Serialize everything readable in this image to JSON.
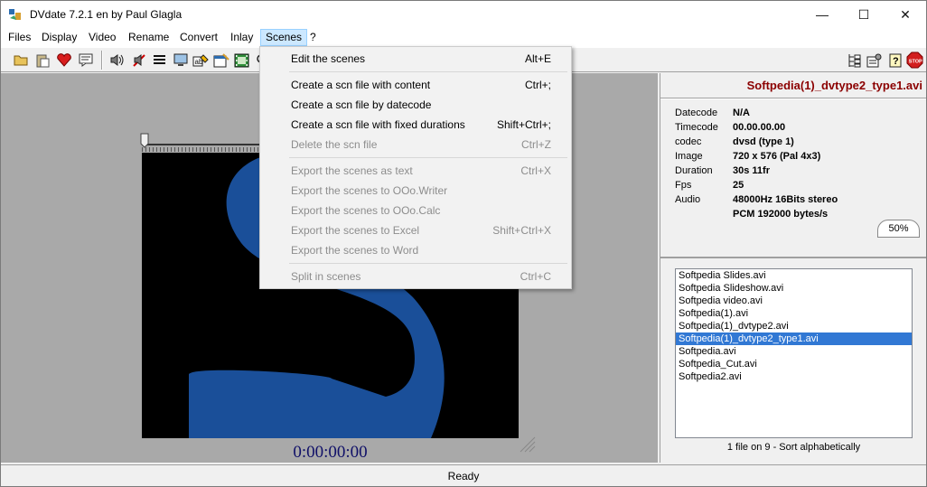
{
  "window": {
    "title": "DVdate 7.2.1 en by Paul Glagla",
    "min_glyph": "—",
    "max_glyph": "☐",
    "close_glyph": "✕"
  },
  "menubar": {
    "items": [
      {
        "label": "Files"
      },
      {
        "label": "Display"
      },
      {
        "label": "Video"
      },
      {
        "label": "Rename"
      },
      {
        "label": "Convert"
      },
      {
        "label": "Inlay"
      },
      {
        "label": "Scenes"
      },
      {
        "label": "?"
      }
    ],
    "active": "Scenes"
  },
  "toolbar": {
    "icons": [
      "open-folder-icon",
      "paste-icon",
      "favorite-heart-icon",
      "comment-icon",
      "speaker-icon",
      "mute-icon",
      "list-icon",
      "monitor-icon",
      "rename-icon",
      "calendar-icon",
      "film-icon",
      "search-icon",
      "tree-view-icon",
      "settings-icon",
      "help-icon",
      "stop-icon"
    ]
  },
  "scenes_menu": {
    "items": [
      {
        "label": "Edit the scenes",
        "shortcut": "Alt+E",
        "enabled": true
      },
      {
        "label": "Create a scn file with content",
        "shortcut": "Ctrl+;",
        "enabled": true
      },
      {
        "label": "Create a scn file by datecode",
        "shortcut": "",
        "enabled": true
      },
      {
        "label": "Create a scn file with fixed durations",
        "shortcut": "Shift+Ctrl+;",
        "enabled": true
      },
      {
        "label": "Delete the scn file",
        "shortcut": "Ctrl+Z",
        "enabled": false
      },
      {
        "label": "Export the scenes as text",
        "shortcut": "Ctrl+X",
        "enabled": false
      },
      {
        "label": "Export the scenes to OOo.Writer",
        "shortcut": "",
        "enabled": false
      },
      {
        "label": "Export the scenes to OOo.Calc",
        "shortcut": "",
        "enabled": false
      },
      {
        "label": "Export the scenes to Excel",
        "shortcut": "Shift+Ctrl+X",
        "enabled": false
      },
      {
        "label": "Export the scenes to Word",
        "shortcut": "",
        "enabled": false
      },
      {
        "label": "Split in scenes",
        "shortcut": "Ctrl+C",
        "enabled": false
      }
    ]
  },
  "player": {
    "timecode": "0:00:00:00"
  },
  "info": {
    "file_title": "Softpedia(1)_dvtype2_type1.avi",
    "fields": [
      {
        "label": "Datecode",
        "value": "N/A"
      },
      {
        "label": "Timecode",
        "value": "00.00.00.00"
      },
      {
        "label": "codec",
        "value": "dvsd (type 1)"
      },
      {
        "label": "Image",
        "value": "720 x 576 (Pal 4x3)"
      },
      {
        "label": "Duration",
        "value": "30s 11fr"
      },
      {
        "label": "Fps",
        "value": "25"
      },
      {
        "label": "Audio",
        "value": "48000Hz 16Bits stereo"
      },
      {
        "label": "",
        "value": "PCM 192000 bytes/s"
      }
    ],
    "zoom": "50%"
  },
  "file_list": {
    "files": [
      "Softpedia Slides.avi",
      "Softpedia Slideshow.avi",
      "Softpedia video.avi",
      "Softpedia(1).avi",
      "Softpedia(1)_dvtype2.avi",
      "Softpedia(1)_dvtype2_type1.avi",
      "Softpedia.avi",
      "Softpedia_Cut.avi",
      "Softpedia2.avi"
    ],
    "selected_index": 5,
    "status": "1 file on 9 - Sort alphabetically"
  },
  "statusbar": {
    "text": "Ready"
  },
  "colors": {
    "file_title": "#8b0000",
    "selection": "#3178d4",
    "logo_blue": "#1a4f99",
    "timecode": "#101068"
  }
}
